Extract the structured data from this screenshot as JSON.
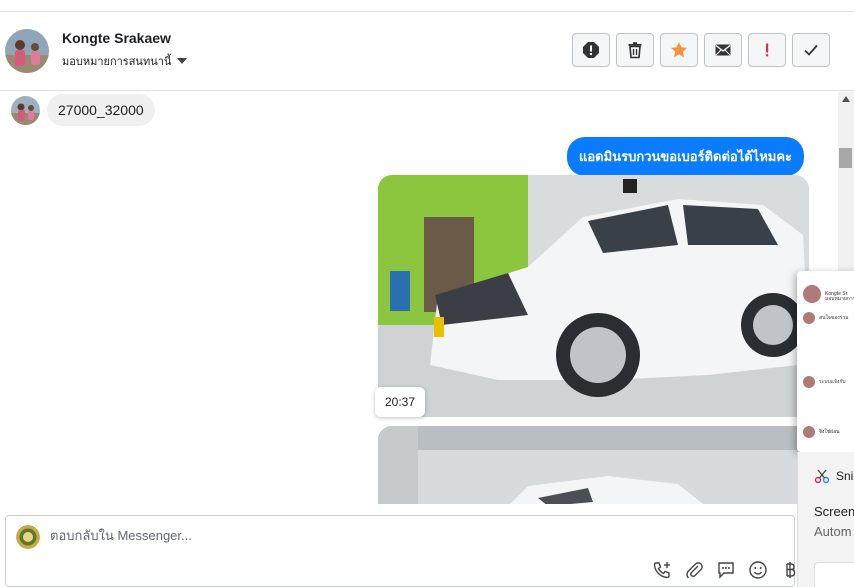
{
  "header": {
    "contact_name": "Kongte Srakaew",
    "assign_label": "มอบหมายการสนทนานี้"
  },
  "toolbar": {
    "buttons": [
      {
        "name": "spam-icon",
        "color": "#444444"
      },
      {
        "name": "trash-icon",
        "color": "#444444"
      },
      {
        "name": "star-icon",
        "color": "#f7923b"
      },
      {
        "name": "mail-icon",
        "color": "#444444"
      },
      {
        "name": "follow-up-icon",
        "color": "#e4322b"
      },
      {
        "name": "check-icon",
        "color": "#444444"
      }
    ]
  },
  "thread": {
    "incoming_text": "27000_32000",
    "outgoing_text": "แอดมินรบกวนขอเบอร์ติดต่อได้ไหมคะ",
    "photo_timestamp": "20:37"
  },
  "popup": {
    "rows": [
      {
        "text": "Kongte Sr"
      },
      {
        "text": "มอบหมายการ"
      },
      {
        "text": "สนใจของร่วม"
      },
      {
        "text": "ระบบแจ้งกับ"
      },
      {
        "text": "จิงใช่ผ่อน"
      }
    ]
  },
  "snip": {
    "title": "Snip",
    "line1": "Screen",
    "line2": "Autom"
  },
  "composer": {
    "placeholder": "ตอบกลับใน Messenger...",
    "value": "",
    "icons": [
      "phone-add-icon",
      "paperclip-icon",
      "chat-bubble-icon",
      "emoji-icon",
      "baht-icon"
    ]
  },
  "colors": {
    "accent": "#0a7cff",
    "bubble_in": "#f0f0f0",
    "star": "#f7923b",
    "flag": "#e4322b"
  }
}
